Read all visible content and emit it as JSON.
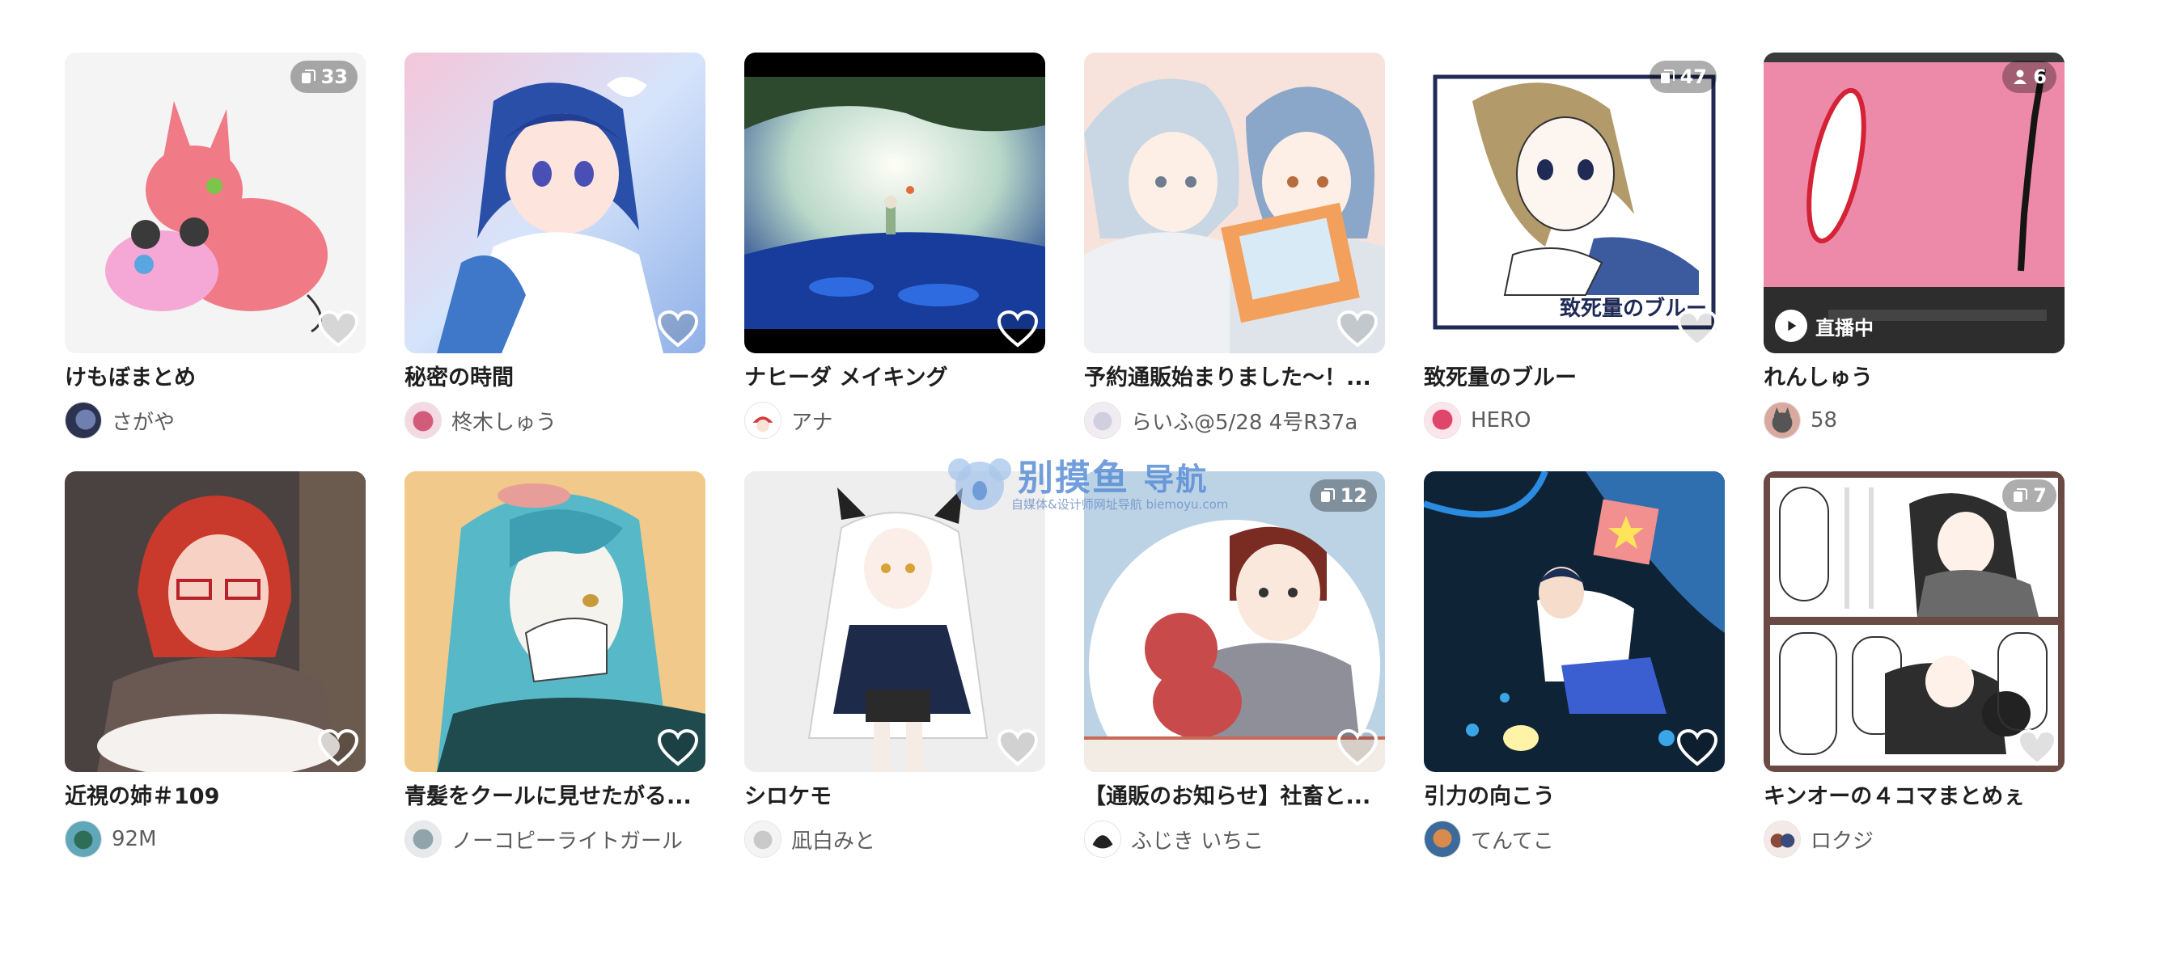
{
  "cards": [
    {
      "title": "けもぼまとめ",
      "author": "さがや",
      "badge": {
        "type": "pages",
        "count": "33"
      },
      "live": null
    },
    {
      "title": "秘密の時間",
      "author": "柊木しゅう",
      "badge": null,
      "live": null
    },
    {
      "title": "ナヒーダ メイキング",
      "author": "アナ",
      "badge": null,
      "live": null
    },
    {
      "title": "予約通販始まりました～！...",
      "author": "らいふ@5/28 4号R37a",
      "badge": null,
      "live": null
    },
    {
      "title": "致死量のブルー",
      "author": "HERO",
      "badge": {
        "type": "pages",
        "count": "47"
      },
      "live": null,
      "art_caption": "致死量のブルー"
    },
    {
      "title": "れんしゅう",
      "author": "58",
      "badge": {
        "type": "people",
        "count": "6"
      },
      "live": "直播中"
    },
    {
      "title": "近視の姉＃109",
      "author": "92M",
      "badge": null,
      "live": null
    },
    {
      "title": "青髪をクールに見せたがる...",
      "author": "ノーコピーライトガール",
      "badge": null,
      "live": null
    },
    {
      "title": "シロケモ",
      "author": "凪白みと",
      "badge": null,
      "live": null
    },
    {
      "title": "【通販のお知らせ】社畜と...",
      "author": "ふじき いちこ",
      "badge": {
        "type": "pages",
        "count": "12"
      },
      "live": null
    },
    {
      "title": "引力の向こう",
      "author": "てんてこ",
      "badge": null,
      "live": null
    },
    {
      "title": "キンオーの４コマまとめぇ",
      "author": "ロクジ",
      "badge": {
        "type": "pages",
        "count": "7"
      },
      "live": null
    }
  ],
  "watermark": {
    "title": "别摸鱼",
    "title_suffix": "导航",
    "subtitle": "自媒体&设计师网址导航 biemoyu.com"
  }
}
